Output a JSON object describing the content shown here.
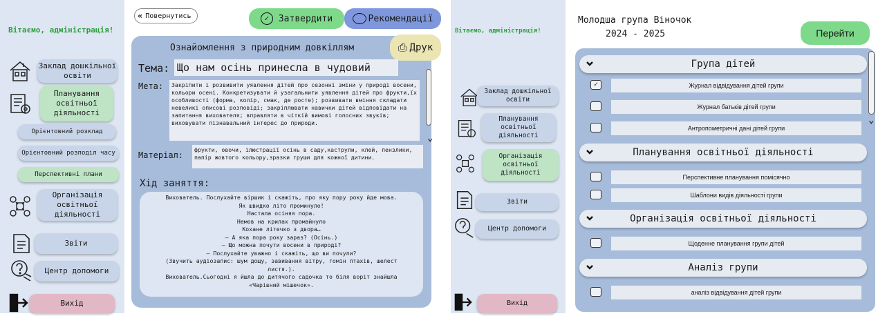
{
  "screen1": {
    "greeting": "Вітаємо, адміністрація!",
    "nav": {
      "institution": "Заклад дошкільної освіти",
      "planning": "Планування освітньої діяльності",
      "approx_schedule": "Орієнтовний розклад",
      "time_distribution": "Орієнтовний розподіл часу",
      "perspective_plans": "Перспективні плани",
      "organization": "Організація освітньої діяльності",
      "reports": "Звіти",
      "help_center": "Центр допомоги",
      "exit": "Вихід"
    }
  },
  "screen2": {
    "back": "Повернутись",
    "approve": "Затвердити",
    "recommendations": "Рекомендації",
    "print": "Друк",
    "heading": "Ознайомлення з природним довкіллям",
    "topic_label": "Тема:",
    "topic": "Що нам осінь принесла в чудовий сад?",
    "goal_label": "Мета:",
    "goal": "Закріпити і розвивити уявлення дітей про сезонні зміни у природі восени, кольори осені. Конкретизувати й узагальнити уявлення дітей про фрукти,їх особливості (форма, колір, смак, де росте); розвивати вміння складати невеликі описові розповіді; закріплювати навички дітей відповідати на запитання вихователя; вправляти в чіткій вимові голосних звуків; виховувати пізнавальний інтерес до природи.",
    "material_label": "Матеріал:",
    "material": "фрукти, овочи, ілюстрації осінь в саду,каструли, клей, пензлики, папір жовтого кольору,зразки груши для кожної дитини.",
    "lesson_label": "Хід заняття:",
    "lesson_lines": [
      "Вихователь. Послухайте віршик і скажіть, про яку пору року йде мова.",
      "Як швидко літо проминуло!",
      "Настала осіняя пора.",
      "Немов на крилах промайнуло",
      "Кохане літечко з двора…",
      "– А яка пора року зараз? (Осінь.)",
      "– Що можна почути восени в природі?",
      "– Послухайте уважно і скажіть, що ви почули?",
      "(Звучить аудіозапис: шум дощу, завивання вітру, гомін птахів, шелест",
      "листя.).",
      "Вихователь.Сьогодні я йшла до дитячого садочка то біля воріт  знайшла",
      "«Чарівний мішечок»."
    ]
  },
  "screen3": {
    "greeting": "Вітаємо, адміністрація!",
    "nav": {
      "institution": "Заклад дошкільної освіти",
      "planning": "Планування освітньої діяльності",
      "organization": "Організація освітньої діяльності",
      "reports": "Звіти",
      "help_center": "Центр допомоги",
      "exit": "Вихід"
    }
  },
  "screen4": {
    "group_title": "Молодша група Віночок",
    "years": "2024 - 2025",
    "go": "Перейти",
    "sections": [
      {
        "title": "Група дітей",
        "items": [
          {
            "label": "Журнал відвідування дітей групи",
            "checked": true
          },
          {
            "label": "Журнал батьків дітей групи",
            "checked": false
          },
          {
            "label": "Антропометричні дані дітей групи",
            "checked": false
          }
        ]
      },
      {
        "title": "Планування освітньої діяльності",
        "items": [
          {
            "label": "Перспективне планування помісячно",
            "checked": false
          },
          {
            "label": "Шаблони видів діяльності  групи",
            "checked": false
          }
        ]
      },
      {
        "title": "Організація освітньої діяльності",
        "items": [
          {
            "label": "Щоденне планування групи дітей",
            "checked": false
          }
        ]
      },
      {
        "title": "Аналіз групи",
        "items": [
          {
            "label": "аналіз відвідування дітей групи",
            "checked": false
          }
        ]
      }
    ]
  },
  "colors": {
    "panel_bg": "#dde6f2",
    "content_blue": "#a7bcdb",
    "button_blue": "#c8d5e8",
    "green": "#2e9e3f",
    "green_button": "#7ed98a",
    "pink": "#e2b8c6"
  }
}
